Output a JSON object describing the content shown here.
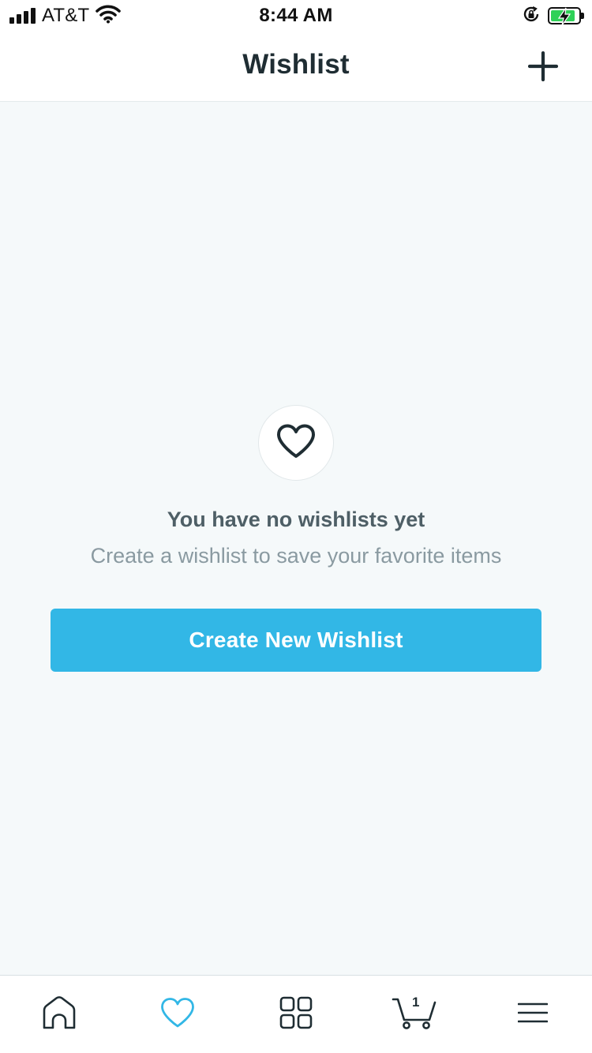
{
  "status_bar": {
    "carrier": "AT&T",
    "time": "8:44 AM",
    "icons": [
      "signal-icon",
      "wifi-icon",
      "orientation-lock-icon",
      "battery-charging-icon"
    ]
  },
  "header": {
    "title": "Wishlist",
    "add_icon": "plus-icon"
  },
  "empty_state": {
    "icon": "heart-icon",
    "title": "You have no wishlists yet",
    "subtitle": "Create a wishlist to save your favorite items",
    "button_label": "Create New Wishlist"
  },
  "tab_bar": {
    "tabs": [
      {
        "icon": "home-icon",
        "active": false
      },
      {
        "icon": "heart-icon",
        "active": true
      },
      {
        "icon": "grid-icon",
        "active": false
      },
      {
        "icon": "cart-icon",
        "active": false,
        "badge": "1"
      },
      {
        "icon": "menu-icon",
        "active": false
      }
    ]
  },
  "colors": {
    "accent": "#32b7e6",
    "background": "#f5f9fa",
    "text_dark": "#1f2d33",
    "text_muted": "#8a9aa1",
    "battery_green": "#2fd158"
  }
}
